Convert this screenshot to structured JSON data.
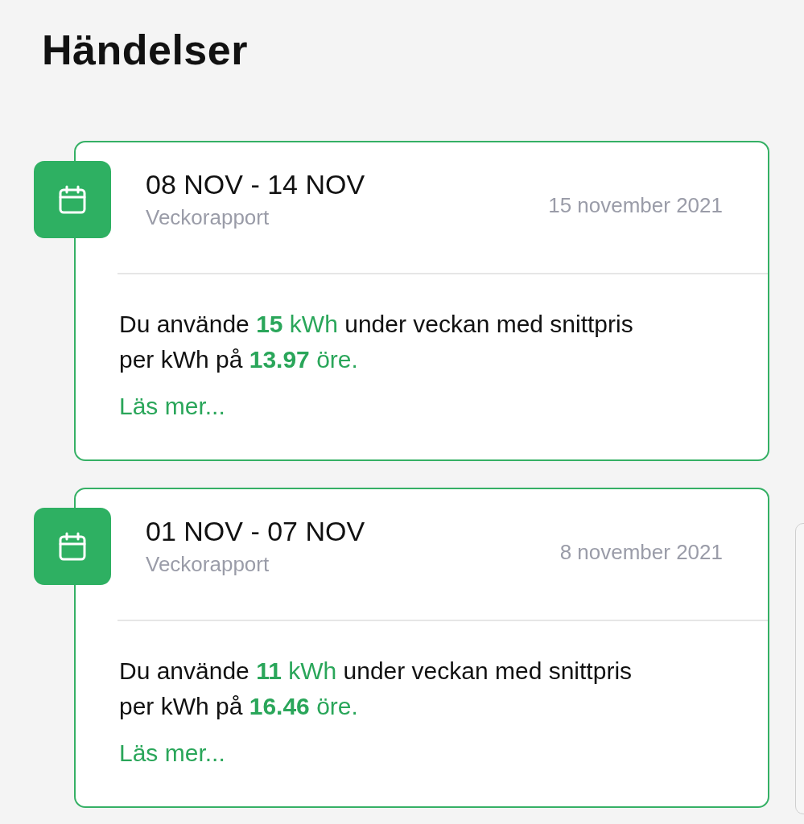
{
  "title": "Händelser",
  "events": [
    {
      "period": "08 NOV - 14 NOV",
      "type": "Veckorapport",
      "date": "15 november 2021",
      "summary": [
        {
          "kind": "plain",
          "text": "Du använde "
        },
        {
          "kind": "value",
          "text": "15"
        },
        {
          "kind": "unit",
          "text": " kWh"
        },
        {
          "kind": "plain",
          "text": " under veckan med snittpris per kWh på "
        },
        {
          "kind": "value",
          "text": "13.97"
        },
        {
          "kind": "unit",
          "text": " öre."
        }
      ],
      "link": "Läs mer..."
    },
    {
      "period": "01 NOV - 07 NOV",
      "type": "Veckorapport",
      "date": "8 november 2021",
      "summary": [
        {
          "kind": "plain",
          "text": "Du använde "
        },
        {
          "kind": "value",
          "text": "11"
        },
        {
          "kind": "unit",
          "text": " kWh"
        },
        {
          "kind": "plain",
          "text": " under veckan med snittpris per kWh på "
        },
        {
          "kind": "value",
          "text": "16.46"
        },
        {
          "kind": "unit",
          "text": " öre."
        }
      ],
      "link": "Läs mer..."
    }
  ]
}
